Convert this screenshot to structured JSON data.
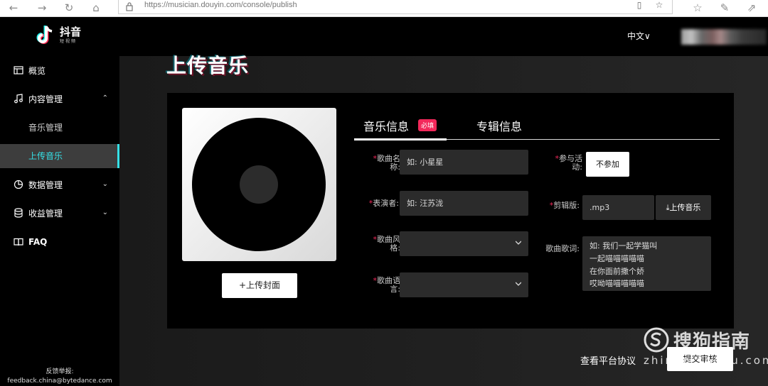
{
  "browser": {
    "url": "https://musician.douyin.com/console/publish"
  },
  "header": {
    "logo_title": "抖音",
    "logo_sub": "短视频",
    "language": "中文∨"
  },
  "sidebar": {
    "items": [
      {
        "label": "概览"
      },
      {
        "label": "内容管理"
      },
      {
        "label": "音乐管理"
      },
      {
        "label": "上传音乐"
      },
      {
        "label": "数据管理"
      },
      {
        "label": "收益管理"
      },
      {
        "label": "FAQ"
      }
    ],
    "feedback_label": "反馈举报:",
    "feedback_email": "feedback.china@bytedance.com"
  },
  "main": {
    "page_title": "上传音乐",
    "upload_cover_label": "+上传封面",
    "tabs": [
      {
        "label": "音乐信息"
      },
      {
        "label": "专辑信息"
      }
    ],
    "required_badge": "必填",
    "form": {
      "song_name_label_1": "歌曲名",
      "song_name_label_2": "称:",
      "song_name_placeholder": "如: 小星星",
      "performer_label": "表演者:",
      "performer_placeholder": "如: 汪苏泷",
      "style_label_1": "歌曲风",
      "style_label_2": "格:",
      "language_label_1": "歌曲语",
      "language_label_2": "言:",
      "activity_label_1": "参与活",
      "activity_label_2": "动:",
      "activity_value": "不参加",
      "clip_label": "剪辑版:",
      "clip_value": ".mp3",
      "upload_music_label": "上传音乐",
      "lyrics_label": "歌曲歌词:",
      "lyrics_lines": [
        "如: 我们一起学猫叫",
        "一起喵喵喵喵喵",
        "在你面前撒个娇",
        "哎呦喵喵喵喵喵"
      ]
    },
    "agreement_link": "查看平台协议",
    "submit_label": "提交审核"
  },
  "watermark": {
    "main": "搜狗指南",
    "sub": "zhinan.sogou.com"
  },
  "colors": {
    "accent": "#35e0e6",
    "required": "#f2285a"
  }
}
